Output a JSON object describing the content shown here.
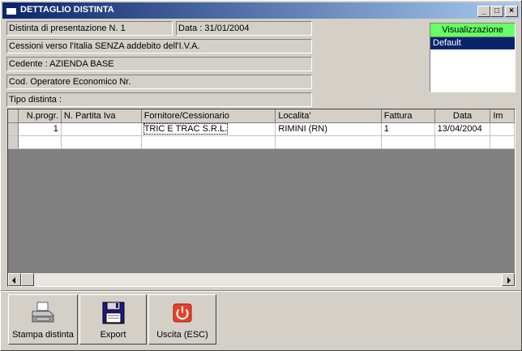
{
  "window": {
    "title": "DETTAGLIO DISTINTA",
    "controls": {
      "minimize": "_",
      "maximize": "□",
      "close": "×"
    }
  },
  "info": {
    "distinta": "Distinta di presentazione N. 1",
    "data": "Data : 31/01/2004",
    "cessioni": "Cessioni verso l'Italia SENZA addebito dell'I.V.A.",
    "cedente": "Cedente : AZIENDA BASE",
    "cod_operatore": "Cod. Operatore Economico Nr.",
    "tipo_distinta": "Tipo distinta :"
  },
  "visualizzazione": {
    "header": "Visualizzazione",
    "items": [
      "Default"
    ]
  },
  "grid": {
    "columns": [
      "N.progr.",
      "N. Partita Iva",
      "Fornitore/Cessionario",
      "Localita'",
      "Fattura",
      "Data",
      "Im"
    ],
    "rows": [
      [
        "1",
        "",
        "TRIC E TRAC S.R.L.",
        "RIMINI (RN)",
        "1",
        "13/04/2004",
        ""
      ]
    ]
  },
  "toolbar": {
    "stampa": "Stampa distinta",
    "export": "Export",
    "uscita": "Uscita (ESC)"
  },
  "colors": {
    "title_bar": "#0a246a",
    "visualizzazione_header": "#66ff66",
    "selected_item": "#0a246a",
    "grid_background": "#808080",
    "exit_icon": "#e8412c"
  }
}
